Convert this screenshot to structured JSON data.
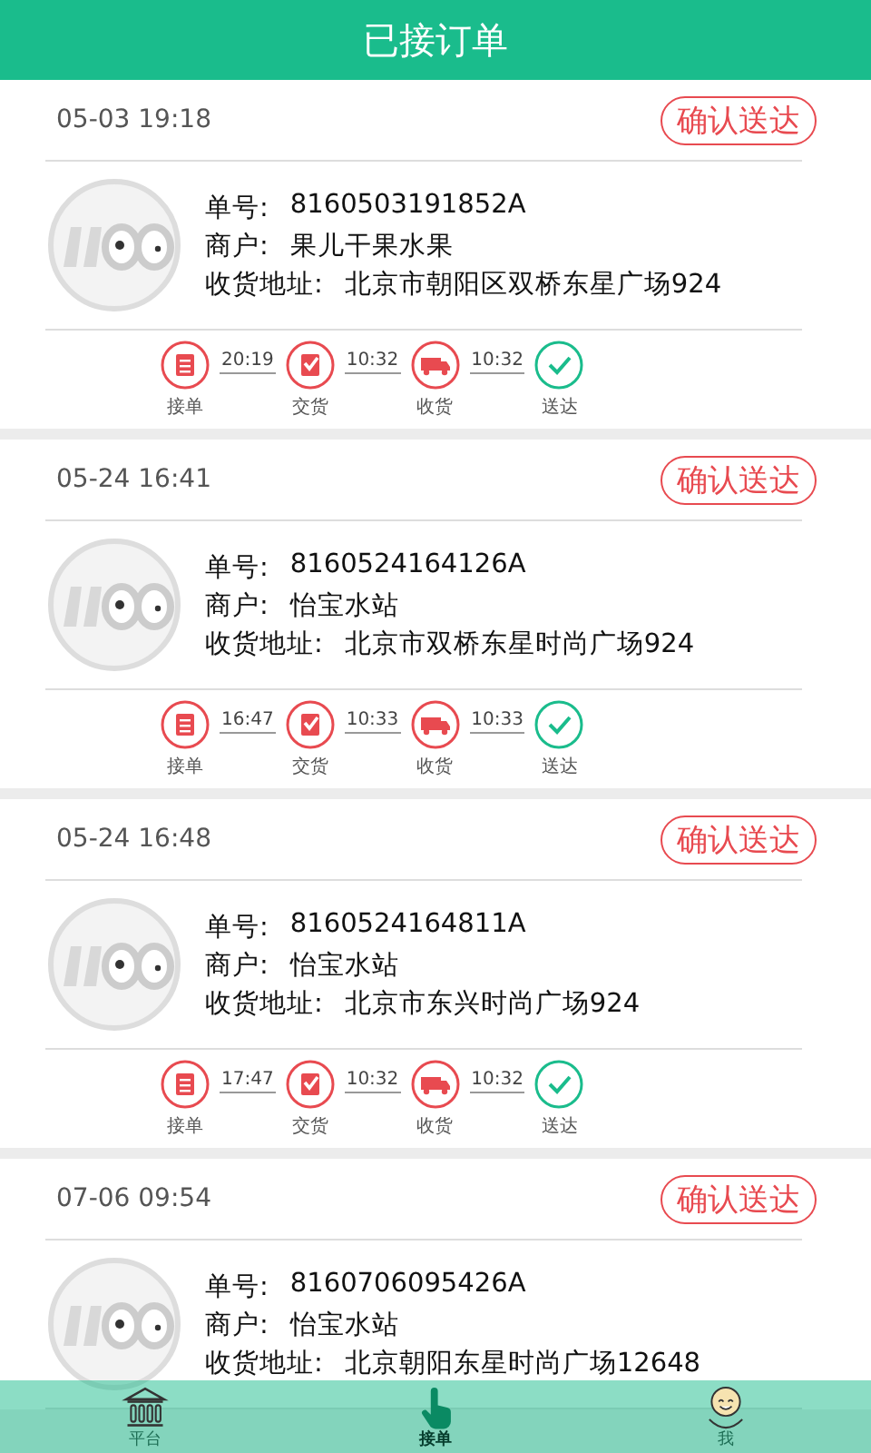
{
  "header": {
    "title": "已接订单"
  },
  "orders": [
    {
      "time": "05-03 19:18",
      "action": "确认送达",
      "order_label": "单号:",
      "order_no": "8160503191852A",
      "merchant_label": "商户:",
      "merchant": "果儿干果水果",
      "address_label": "收货地址:",
      "address": "北京市朝阳区双桥东星广场924",
      "steps": [
        {
          "kind": "order",
          "label": "接单"
        },
        {
          "kind": "handover",
          "label": "交货"
        },
        {
          "kind": "receive",
          "label": "收货"
        },
        {
          "kind": "done",
          "label": "送达"
        }
      ],
      "step_times": [
        "20:19",
        "10:32",
        "10:32"
      ]
    },
    {
      "time": "05-24 16:41",
      "action": "确认送达",
      "order_label": "单号:",
      "order_no": "8160524164126A",
      "merchant_label": "商户:",
      "merchant": "怡宝水站",
      "address_label": "收货地址:",
      "address": "北京市双桥东星时尚广场924",
      "steps": [
        {
          "kind": "order",
          "label": "接单"
        },
        {
          "kind": "handover",
          "label": "交货"
        },
        {
          "kind": "receive",
          "label": "收货"
        },
        {
          "kind": "done",
          "label": "送达"
        }
      ],
      "step_times": [
        "16:47",
        "10:33",
        "10:33"
      ]
    },
    {
      "time": "05-24 16:48",
      "action": "确认送达",
      "order_label": "单号:",
      "order_no": "8160524164811A",
      "merchant_label": "商户:",
      "merchant": "怡宝水站",
      "address_label": "收货地址:",
      "address": "北京市东兴时尚广场924",
      "steps": [
        {
          "kind": "order",
          "label": "接单"
        },
        {
          "kind": "handover",
          "label": "交货"
        },
        {
          "kind": "receive",
          "label": "收货"
        },
        {
          "kind": "done",
          "label": "送达"
        }
      ],
      "step_times": [
        "17:47",
        "10:32",
        "10:32"
      ]
    },
    {
      "time": "07-06 09:54",
      "action": "确认送达",
      "order_label": "单号:",
      "order_no": "8160706095426A",
      "merchant_label": "商户:",
      "merchant": "怡宝水站",
      "address_label": "收货地址:",
      "address": "北京朝阳东星时尚广场12648"
    }
  ],
  "nav": [
    {
      "kind": "platform",
      "label": "平台",
      "selected": false
    },
    {
      "kind": "orders",
      "label": "接单",
      "selected": true
    },
    {
      "kind": "me",
      "label": "我",
      "selected": false
    }
  ]
}
